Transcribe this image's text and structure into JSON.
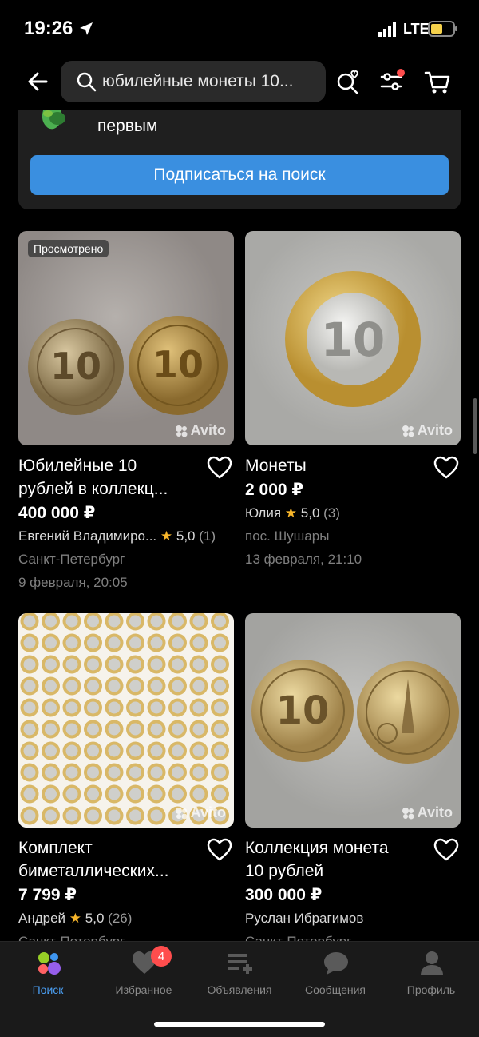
{
  "status_bar": {
    "time": "19:26",
    "network": "LTE"
  },
  "header": {
    "search_value": "юбилейные монеты 10...",
    "icons": [
      "back-arrow-icon",
      "search-icon",
      "favorite-search-icon",
      "filter-icon",
      "cart-icon"
    ]
  },
  "subscribe": {
    "text_fragment": "первым",
    "button_label": "Подписаться на поиск"
  },
  "watermark": "Avito",
  "listings": [
    {
      "badge": "Просмотрено",
      "title_line1": "Юбилейные 10",
      "title_line2": "рублей в коллекц...",
      "price": "400 000 ₽",
      "seller": "Евгений Владимиро...",
      "rating": "5,0",
      "reviews": "(1)",
      "location": "Санкт-Петербург",
      "date": "9 февраля, 20:05"
    },
    {
      "title_line1": "Монеты",
      "price": "2 000 ₽",
      "seller": "Юлия",
      "rating": "5,0",
      "reviews": "(3)",
      "location": "пос. Шушары",
      "date": "13 февраля, 21:10"
    },
    {
      "title_line1": "Комплект",
      "title_line2": "биметаллических...",
      "price": "7 799 ₽",
      "seller": "Андрей",
      "rating": "5,0",
      "reviews": "(26)",
      "location": "Санкт-Петербург"
    },
    {
      "title_line1": "Коллекция монета",
      "title_line2": "10 рублей",
      "price": "300 000 ₽",
      "seller": "Руслан Ибрагимов",
      "location": "Санкт-Петербург"
    }
  ],
  "tabbar": {
    "tabs": [
      {
        "label": "Поиск",
        "active": true
      },
      {
        "label": "Избранное",
        "badge": "4"
      },
      {
        "label": "Объявления"
      },
      {
        "label": "Сообщения"
      },
      {
        "label": "Профиль"
      }
    ]
  },
  "colors": {
    "accent": "#3a8fe0",
    "badge": "#ff4d4d",
    "star": "#f7b52a",
    "background": "#000000"
  }
}
